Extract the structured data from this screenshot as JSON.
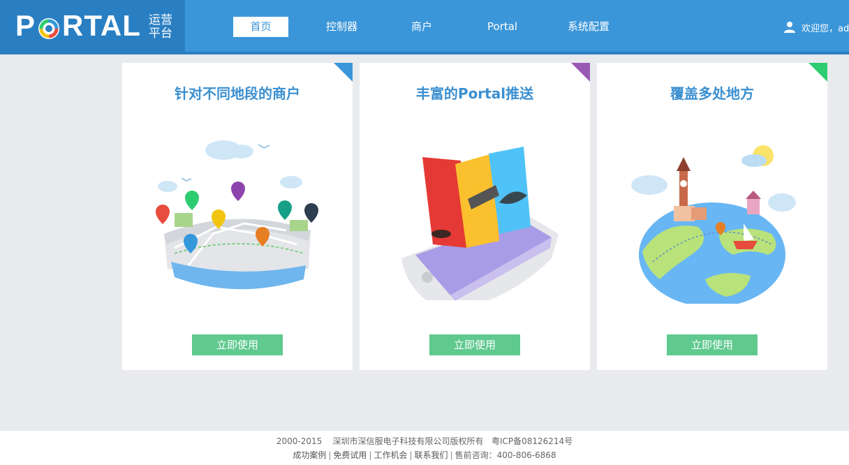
{
  "header": {
    "logo_text_left": "P",
    "logo_text_right": "RTAL",
    "logo_sub_line1": "运营",
    "logo_sub_line2": "平台",
    "nav": [
      {
        "label": "首页",
        "active": true
      },
      {
        "label": "控制器",
        "active": false
      },
      {
        "label": "商户",
        "active": false
      },
      {
        "label": "Portal",
        "active": false
      },
      {
        "label": "系统配置",
        "active": false
      }
    ],
    "user_greeting": "欢迎您，adm",
    "user_icon": "user-icon"
  },
  "cards": [
    {
      "title": "针对不同地段的商户",
      "button": "立即使用",
      "corner_color": "#3b96d9",
      "illustration": "city-map-illustration"
    },
    {
      "title_prefix": "丰富的",
      "title_bold": "Portal",
      "title_suffix": "推送",
      "button": "立即使用",
      "corner_color": "#9b59b6",
      "illustration": "phone-cards-illustration"
    },
    {
      "title": "覆盖多处地方",
      "button": "立即使用",
      "corner_color": "#2ecc71",
      "illustration": "globe-illustration"
    }
  ],
  "footer": {
    "copyright": "2000-2015    深圳市深信服电子科技有限公司版权所有   粤ICP备08126214号",
    "links": [
      "成功案例",
      "免费试用",
      "工作机会",
      "联系我们"
    ],
    "hotline": "售前咨询：400-806-6868"
  },
  "colors": {
    "header_bg": "#3b96d9",
    "logo_bg": "#2a7fc2",
    "title_blue": "#3b8fd0",
    "button_green": "#5fc98e",
    "page_bg": "#e8eaee"
  }
}
